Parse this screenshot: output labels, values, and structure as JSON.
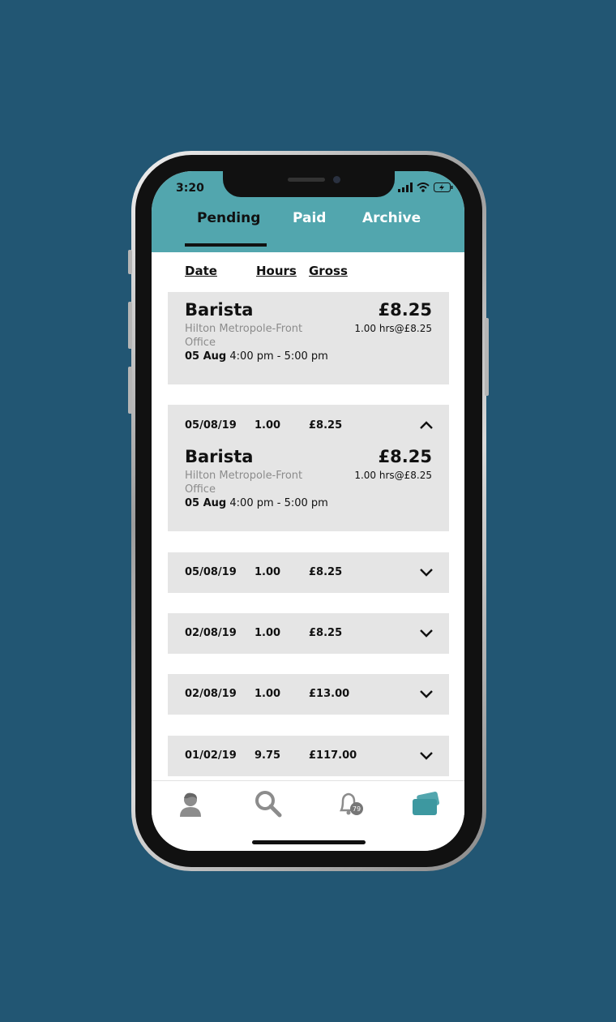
{
  "status_bar": {
    "time": "3:20"
  },
  "tabs": [
    {
      "label": "Pending",
      "active": true
    },
    {
      "label": "Paid",
      "active": false
    },
    {
      "label": "Archive",
      "active": false
    }
  ],
  "columns": {
    "date": "Date",
    "hours": "Hours",
    "gross": "Gross"
  },
  "first_card": {
    "title": "Barista",
    "amount": "£8.25",
    "location": "Hilton Metropole-Front Office",
    "rate": "1.00 hrs@£8.25",
    "shift_date": "05 Aug",
    "shift_time": "4:00 pm - 5:00 pm"
  },
  "expanded_row": {
    "date": "05/08/19",
    "hours": "1.00",
    "gross": "£8.25",
    "title": "Barista",
    "amount": "£8.25",
    "location": "Hilton Metropole-Front Office",
    "rate": "1.00 hrs@£8.25",
    "shift_date": "05 Aug",
    "shift_time": "4:00 pm - 5:00 pm"
  },
  "rows": [
    {
      "date": "05/08/19",
      "hours": "1.00",
      "gross": "£8.25"
    },
    {
      "date": "02/08/19",
      "hours": "1.00",
      "gross": "£8.25"
    },
    {
      "date": "02/08/19",
      "hours": "1.00",
      "gross": "£13.00"
    },
    {
      "date": "01/02/19",
      "hours": "9.75",
      "gross": "£117.00"
    }
  ],
  "bottom_nav": {
    "items": [
      "profile-icon",
      "search-icon",
      "bell-icon",
      "wallet-icon"
    ],
    "active": "wallet-icon",
    "notification_count": "79"
  },
  "colors": {
    "background": "#225673",
    "accent": "#52a6ae",
    "card": "#e5e5e5"
  }
}
